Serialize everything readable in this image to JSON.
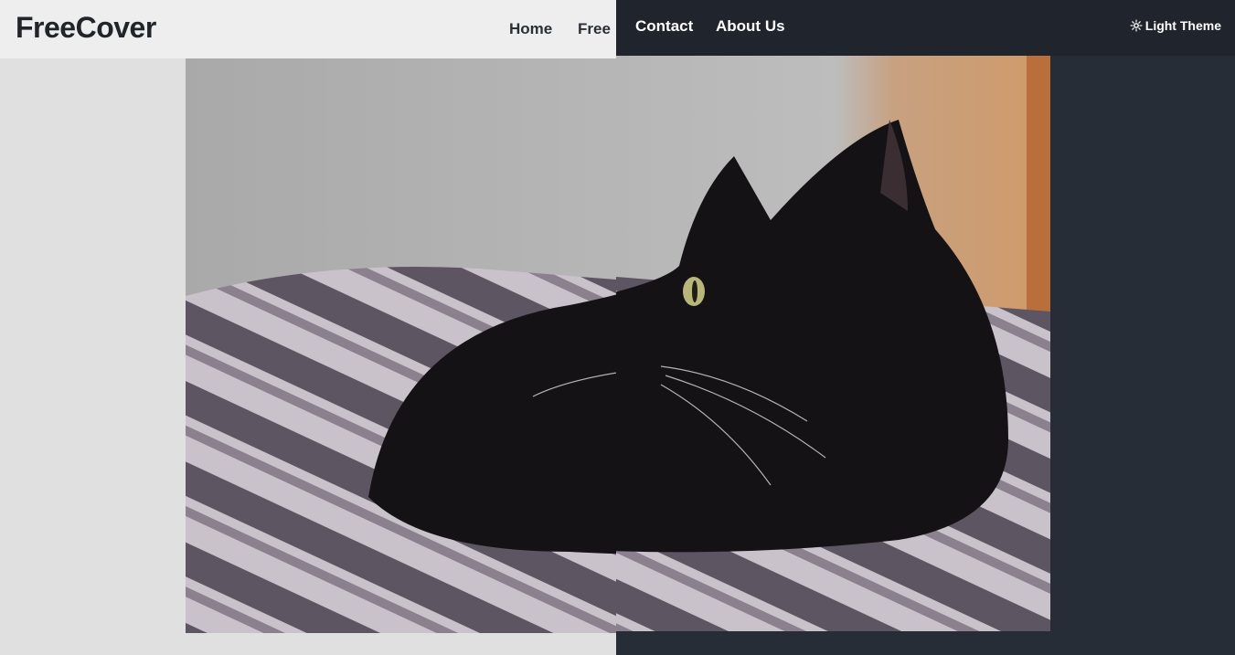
{
  "brand": {
    "name": "FreeCover"
  },
  "nav": {
    "home": "Home",
    "free": "Free",
    "contact": "Contact",
    "about": "About Us"
  },
  "theme_toggle": {
    "label": "Light Theme",
    "icon": "gear-icon"
  },
  "hero_image": {
    "subject": "black-cat-on-striped-bedsheet"
  },
  "colors": {
    "light_bg": "#e0e0e0",
    "light_navbar": "#eeeeee",
    "dark_bg": "#272d36",
    "dark_navbar": "#1f242d",
    "text_dark": "#212529",
    "text_light": "#ffffff"
  }
}
